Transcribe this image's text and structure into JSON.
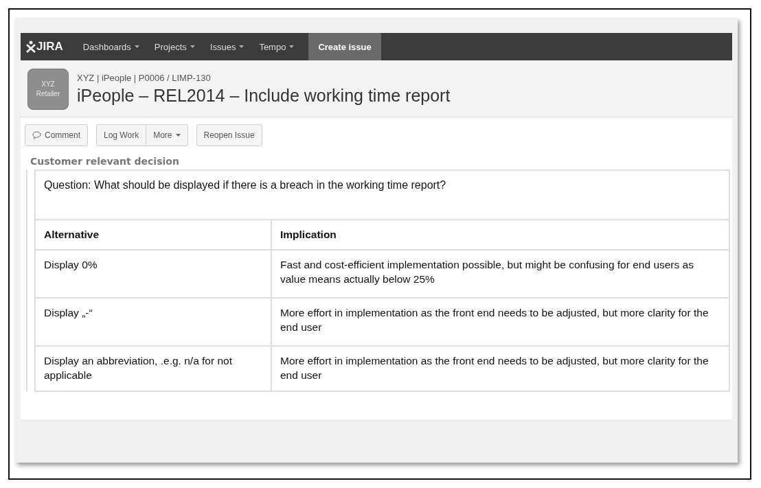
{
  "nav": {
    "logo": "JIRA",
    "menus": [
      "Dashboards",
      "Projects",
      "Issues",
      "Tempo"
    ],
    "create": "Create issue"
  },
  "issue": {
    "avatar": [
      "XYZ",
      "Retailer"
    ],
    "breadcrumb": "XYZ | iPeople | P0006 / LIMP-130",
    "title": "iPeople – REL2014 – Include working time report"
  },
  "toolbar": [
    {
      "label": "Comment",
      "kind": "comment"
    },
    {
      "label": "Log Work",
      "kind": "split"
    },
    {
      "label": "More",
      "kind": "dropdown"
    },
    {
      "label": "Reopen Issue",
      "kind": "plain"
    }
  ],
  "section": "Customer relevant decision",
  "table": {
    "question": "Question: What should be displayed if there is a breach in the working time report?",
    "columns": [
      "Alternative",
      "Implication"
    ],
    "rows": [
      {
        "alternative": "Display 0%",
        "implication": "Fast and cost-efficient implementation possible, but might be confusing for end users as value means actually below 25%"
      },
      {
        "alternative": "Display „-“",
        "implication": "More effort in implementation as the front end needs to be adjusted, but more clarity for the end user"
      },
      {
        "alternative": "Display an abbreviation, .e.g. n/a for not applicable",
        "implication": "More effort in implementation as the front end needs to be adjusted, but more clarity for the end user"
      }
    ]
  }
}
